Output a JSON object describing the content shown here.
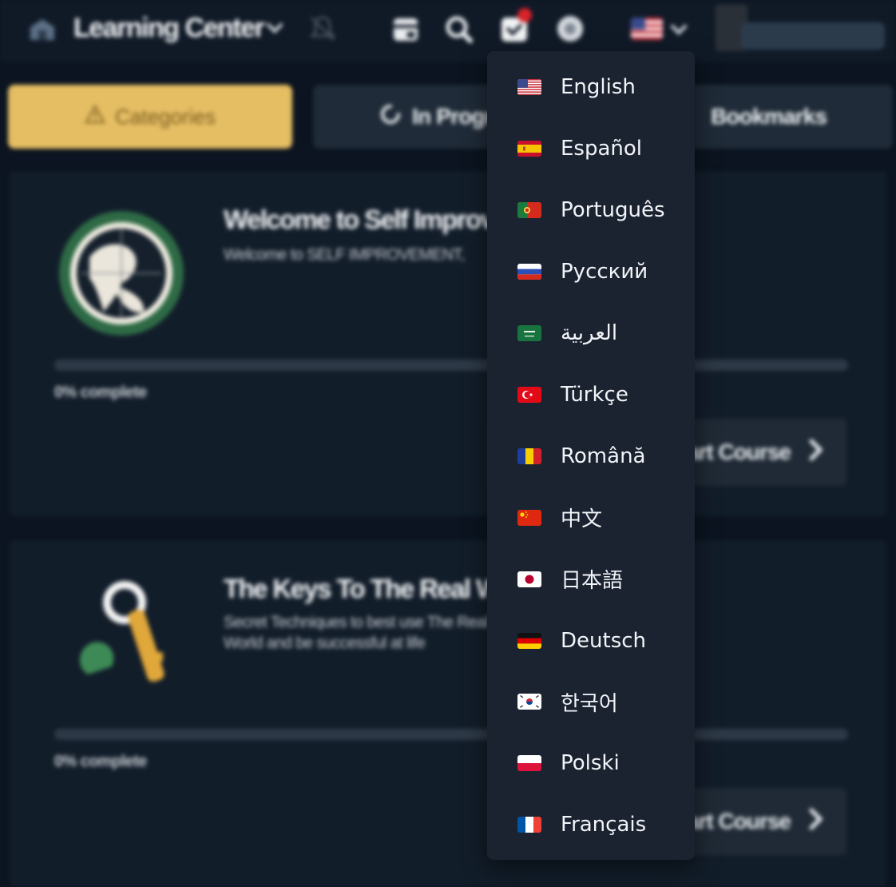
{
  "header": {
    "brand": "Learning Center",
    "notification_count": ""
  },
  "tabs": [
    {
      "label": "Categories",
      "icon": "warning-icon",
      "active": true
    },
    {
      "label": "In Progress",
      "icon": "progress-icon",
      "active": false
    },
    {
      "label": "Bookmarks",
      "icon": "bookmark-icon",
      "active": false
    }
  ],
  "courses": [
    {
      "title": "Welcome to Self Improvement",
      "description": "Welcome to SELF IMPROVEMENT,",
      "progress": 0,
      "progress_text": "0% complete",
      "button": "Start Course"
    },
    {
      "title": "The Keys To The Real World",
      "description": "Secret Techniques to best use The Real World and be successful at life",
      "progress": 0,
      "progress_text": "0% complete",
      "button": "Start Course"
    }
  ],
  "language_menu": {
    "items": [
      {
        "label": "English",
        "flag": "us"
      },
      {
        "label": "Español",
        "flag": "es"
      },
      {
        "label": "Português",
        "flag": "pt"
      },
      {
        "label": "Русский",
        "flag": "ru"
      },
      {
        "label": "العربية",
        "flag": "sa"
      },
      {
        "label": "Türkçe",
        "flag": "tr"
      },
      {
        "label": "Română",
        "flag": "ro"
      },
      {
        "label": "中文",
        "flag": "cn"
      },
      {
        "label": "日本語",
        "flag": "jp"
      },
      {
        "label": "Deutsch",
        "flag": "de"
      },
      {
        "label": "한국어",
        "flag": "kr"
      },
      {
        "label": "Polski",
        "flag": "pl"
      },
      {
        "label": "Français",
        "flag": "fr"
      }
    ]
  },
  "colors": {
    "background": "#0b1420",
    "accent": "#e5bd63",
    "menu_bg": "#1b2331",
    "notification": "#d8232a"
  }
}
